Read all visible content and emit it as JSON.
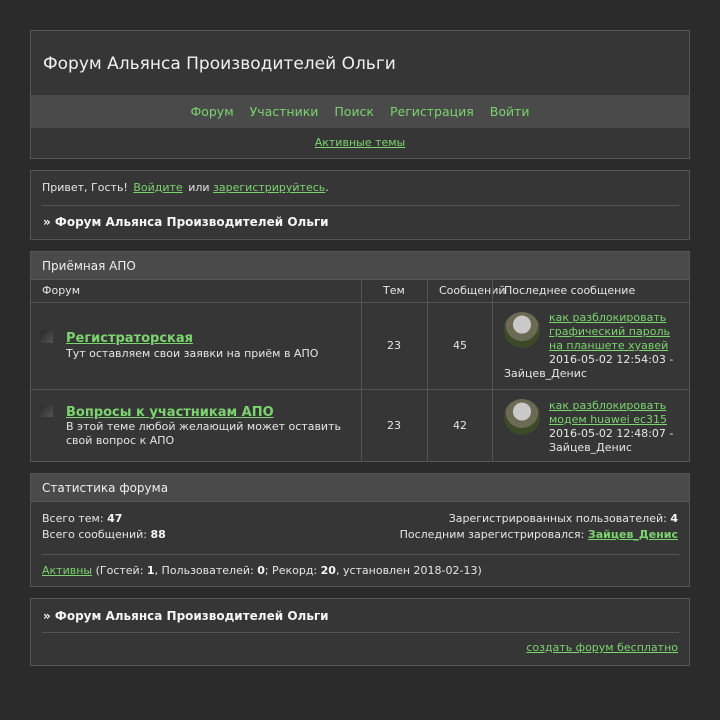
{
  "header": {
    "title": "Форум Альянса Производителей Ольги",
    "nav": [
      "Форум",
      "Участники",
      "Поиск",
      "Регистрация",
      "Войти"
    ],
    "active_topics": "Активные темы"
  },
  "welcome": {
    "greeting": "Привет, Гость!",
    "login": "Войдите",
    "or": "или",
    "register": "зарегистрируйтесь",
    "dot": ".",
    "breadcrumb": "» Форум Альянса Производителей Ольги"
  },
  "category": {
    "title": "Приёмная АПО",
    "columns": [
      "Форум",
      "Тем",
      "Сообщений",
      "Последнее сообщение"
    ],
    "forums": [
      {
        "name": "Регистраторская",
        "description": "Тут оставляем свои заявки на приём в АПО",
        "topics": "23",
        "posts": "45",
        "last_topic": "как разблокировать графический пароль на планшете хуавей",
        "last_date": "2016-05-02 12:54:03 -",
        "last_author": "Зайцев_Денис"
      },
      {
        "name": "Вопросы к участникам АПО",
        "description": "В этой теме любой желающий может оставить свой вопрос к АПО",
        "topics": "23",
        "posts": "42",
        "last_topic": "как разблокировать модем huawei ec315",
        "last_date": "2016-05-02 12:48:07 -",
        "last_author": "Зайцев_Денис"
      }
    ]
  },
  "stats": {
    "title": "Статистика форума",
    "topics_label": "Всего тем:",
    "topics": "47",
    "posts_label": "Всего сообщений:",
    "posts": "88",
    "users_label": "Зарегистрированных пользователей:",
    "users": "4",
    "last_reg_label": "Последним зарегистрировался:",
    "last_reg": "Зайцев_Денис",
    "active_link": "Активны",
    "guests_label": "(Гостей:",
    "guests": "1",
    "members_label": ", Пользователей:",
    "members": "0",
    "record_label": "; Рекорд:",
    "record": "20",
    "record_date": ", установлен 2018-02-13)"
  },
  "footer": {
    "breadcrumb": "» Форум Альянса Производителей Ольги",
    "create_link": "создать форум бесплатно"
  }
}
